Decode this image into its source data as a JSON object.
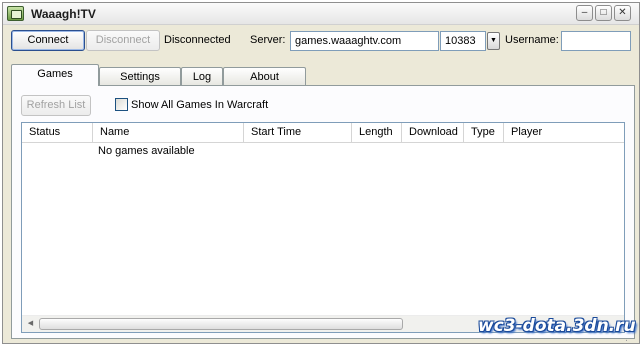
{
  "window": {
    "title": "Waaagh!TV",
    "minimize_glyph": "–",
    "maximize_glyph": "□",
    "close_glyph": "✕"
  },
  "toolbar": {
    "connect_label": "Connect",
    "disconnect_label": "Disconnect",
    "status_text": "Disconnected",
    "server_label": "Server:",
    "server_value": "games.waaaghtv.com",
    "port_value": "10383",
    "port_dropdown_glyph": "▼",
    "username_label": "Username:",
    "username_value": ""
  },
  "tabs": [
    {
      "label": "Games",
      "active": true
    },
    {
      "label": "Settings",
      "active": false
    },
    {
      "label": "Log",
      "active": false
    },
    {
      "label": "About",
      "active": false
    }
  ],
  "games_tab": {
    "refresh_label": "Refresh List",
    "show_all_label": "Show All Games In Warcraft",
    "show_all_checked": false,
    "columns": [
      "Status",
      "Name",
      "Start Time",
      "Length",
      "Download",
      "Type",
      "Player"
    ],
    "empty_message": "No games available",
    "scroll_left_glyph": "◀",
    "scroll_right_glyph": "▶"
  },
  "watermark": "wc3-dota.3dn.ru",
  "colors": {
    "window_bg": "#ece9d8",
    "panel_bg": "#fcfcfe",
    "field_border": "#7f9db9",
    "default_button_border": "#2b4f8f",
    "watermark_outline": "#1a4a9a"
  }
}
